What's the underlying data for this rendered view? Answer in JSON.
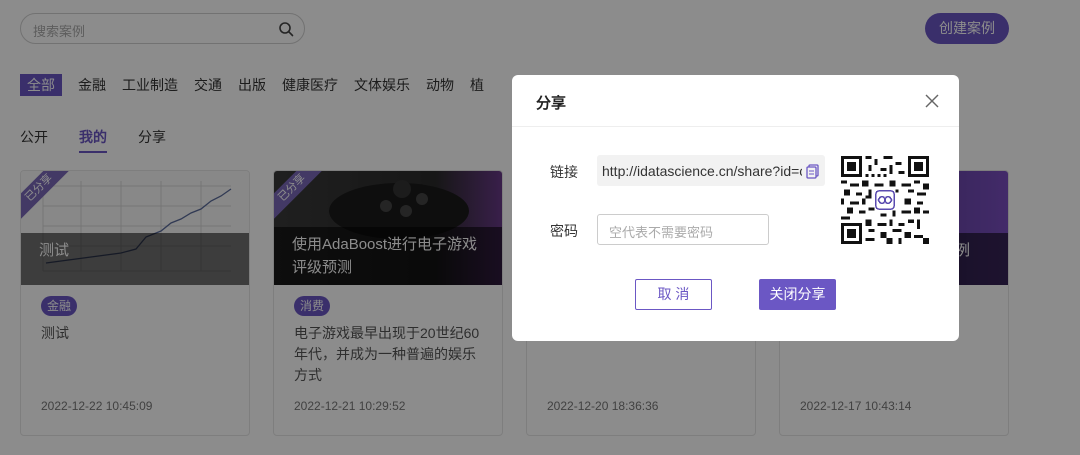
{
  "search": {
    "placeholder": "搜索案例",
    "icon": "search-icon"
  },
  "header": {
    "create_label": "创建案例"
  },
  "categories": [
    "全部",
    "金融",
    "工业制造",
    "交通",
    "出版",
    "健康医疗",
    "文体娱乐",
    "动物",
    "植"
  ],
  "tabs": [
    "公开",
    "我的",
    "分享"
  ],
  "cards": [
    {
      "ribbon": "已分享",
      "title": "测试",
      "tag": "金融",
      "desc": "测试",
      "date": "2022-12-22 10:45:09"
    },
    {
      "ribbon": "已分享",
      "title": "使用AdaBoost进行电子游戏评级预测",
      "tag": "消费",
      "desc": "电子游戏最早出现于20世纪60年代，并成为一种普遍的娱乐方式",
      "date": "2022-12-21 10:29:52"
    },
    {
      "date": "2022-12-20 18:36:36"
    },
    {
      "title": "例",
      "date": "2022-12-17 10:43:14"
    }
  ],
  "modal": {
    "title": "分享",
    "link_label": "链接",
    "link_value": "http://idatascience.cn/share?id=c",
    "password_label": "密码",
    "password_placeholder": "空代表不需要密码",
    "cancel_label": "取 消",
    "close_share_label": "关闭分享"
  },
  "colors": {
    "accent": "#6b57c4"
  }
}
